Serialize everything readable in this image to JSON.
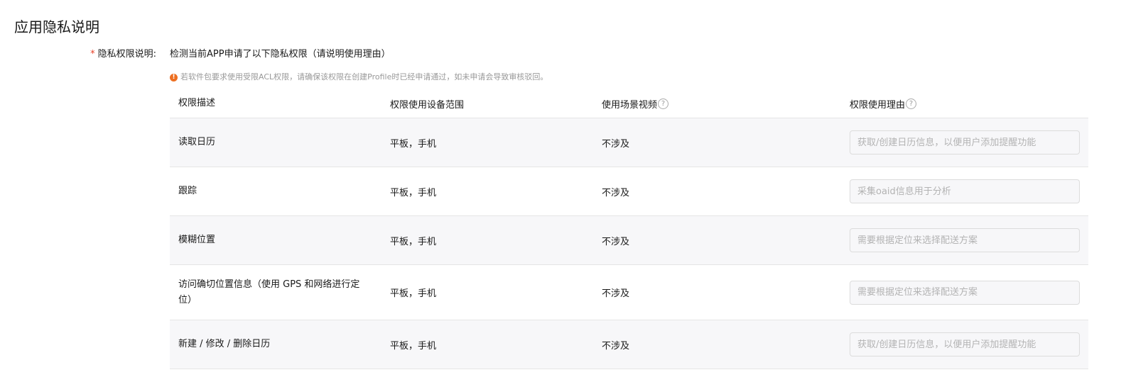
{
  "page": {
    "title": "应用隐私说明"
  },
  "field": {
    "required_mark": "*",
    "label": "隐私权限说明:",
    "description": "检测当前APP申请了以下隐私权限（请说明使用理由）",
    "tip_icon": "!",
    "tip": "若软件包要求使用受限ACL权限，请确保该权限在创建Profile时已经申请通过，如未申请会导致审核驳回。"
  },
  "table": {
    "headers": {
      "description": "权限描述",
      "scope": "权限使用设备范围",
      "video": "使用场景视频",
      "reason": "权限使用理由"
    },
    "help_icon": "?",
    "rows": [
      {
        "description": "读取日历",
        "scope": "平板，手机",
        "video": "不涉及",
        "reason_placeholder": "获取/创建日历信息，以便用户添加提醒功能"
      },
      {
        "description": "跟踪",
        "scope": "平板，手机",
        "video": "不涉及",
        "reason_placeholder": "采集oaid信息用于分析"
      },
      {
        "description": "模糊位置",
        "scope": "平板，手机",
        "video": "不涉及",
        "reason_placeholder": "需要根据定位来选择配送方案"
      },
      {
        "description": "访问确切位置信息（使用 GPS 和网络进行定位）",
        "scope": "平板，手机",
        "video": "不涉及",
        "reason_placeholder": "需要根据定位来选择配送方案"
      },
      {
        "description": "新建 / 修改 / 删除日历",
        "scope": "平板，手机",
        "video": "不涉及",
        "reason_placeholder": "获取/创建日历信息，以便用户添加提醒功能"
      }
    ]
  },
  "colors": {
    "required": "#e84026",
    "warning_icon": "#ed6f21",
    "row_shade": "#f7f7f9",
    "border": "#e5e5e5",
    "tip_text": "#999999"
  }
}
